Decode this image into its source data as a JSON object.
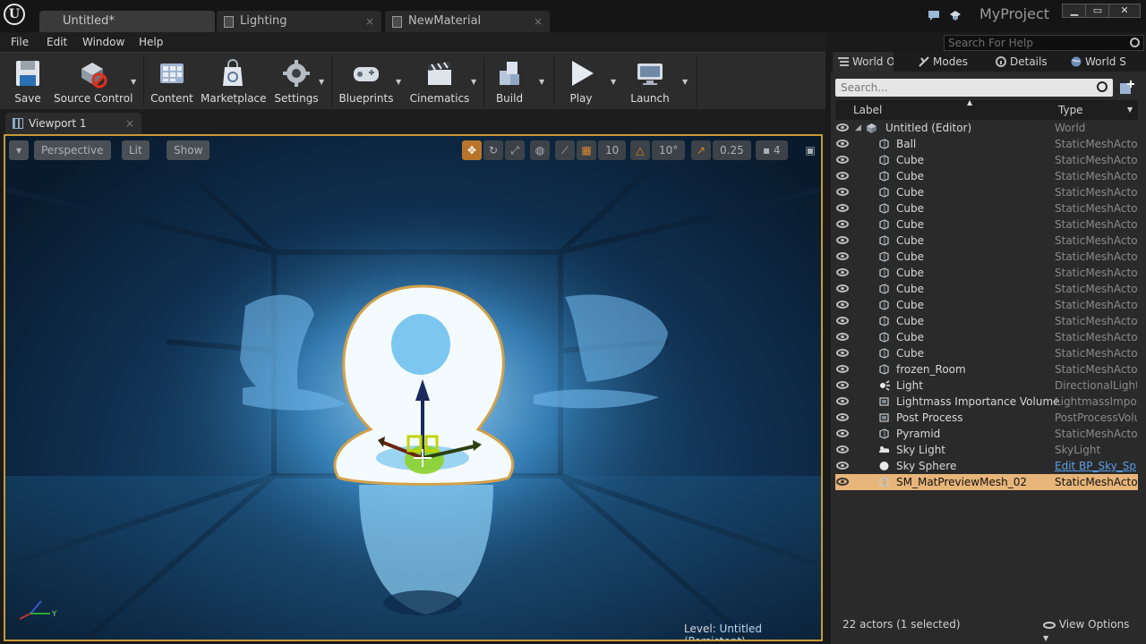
{
  "window": {
    "tabs": [
      {
        "label": "Untitled*",
        "active": true
      },
      {
        "label": "Lighting",
        "active": false
      },
      {
        "label": "NewMaterial",
        "active": false
      }
    ],
    "project_name": "MyProject",
    "close_glyph": "×"
  },
  "menu": [
    "File",
    "Edit",
    "Window",
    "Help"
  ],
  "search_help_placeholder": "Search For Help",
  "toolbar": [
    {
      "label": "Save",
      "icon": "save-icon"
    },
    {
      "label": "Source Control",
      "icon": "source-control-icon",
      "dropdown": true
    },
    {
      "label": "Content",
      "icon": "content-icon"
    },
    {
      "label": "Marketplace",
      "icon": "marketplace-icon"
    },
    {
      "label": "Settings",
      "icon": "settings-icon",
      "dropdown": true
    },
    {
      "label": "Blueprints",
      "icon": "blueprints-icon",
      "dropdown": true
    },
    {
      "label": "Cinematics",
      "icon": "cinematics-icon",
      "dropdown": true
    },
    {
      "label": "Build",
      "icon": "build-icon",
      "dropdown": true
    },
    {
      "label": "Play",
      "icon": "play-icon",
      "dropdown": true
    },
    {
      "label": "Launch",
      "icon": "launch-icon",
      "dropdown": true
    }
  ],
  "viewport": {
    "tab_label": "Viewport 1",
    "perspective": "Perspective",
    "lit": "Lit",
    "show": "Show",
    "grid_snap": "10",
    "rotation_snap": "10°",
    "scale_snap": "0.25",
    "camera_speed": "4",
    "level_label": "Level:",
    "level_name": "Untitled (Persistent)"
  },
  "right_panel": {
    "tabs": [
      {
        "label": "World O",
        "icon": "world-outliner-icon",
        "active": true
      },
      {
        "label": "Modes",
        "icon": "modes-icon"
      },
      {
        "label": "Details",
        "icon": "details-icon"
      },
      {
        "label": "World S",
        "icon": "world-settings-icon"
      }
    ],
    "search_placeholder": "Search...",
    "columns": {
      "label": "Label",
      "type": "Type"
    },
    "rows": [
      {
        "label": "Untitled (Editor)",
        "type": "World",
        "icon": "world-icon",
        "is_world": true
      },
      {
        "label": "Ball",
        "type": "StaticMeshActor",
        "icon": "static-mesh-icon"
      },
      {
        "label": "Cube",
        "type": "StaticMeshActor",
        "icon": "static-mesh-icon"
      },
      {
        "label": "Cube",
        "type": "StaticMeshActor",
        "icon": "static-mesh-icon"
      },
      {
        "label": "Cube",
        "type": "StaticMeshActor",
        "icon": "static-mesh-icon"
      },
      {
        "label": "Cube",
        "type": "StaticMeshActor",
        "icon": "static-mesh-icon"
      },
      {
        "label": "Cube",
        "type": "StaticMeshActor",
        "icon": "static-mesh-icon"
      },
      {
        "label": "Cube",
        "type": "StaticMeshActor",
        "icon": "static-mesh-icon"
      },
      {
        "label": "Cube",
        "type": "StaticMeshActor",
        "icon": "static-mesh-icon"
      },
      {
        "label": "Cube",
        "type": "StaticMeshActor",
        "icon": "static-mesh-icon"
      },
      {
        "label": "Cube",
        "type": "StaticMeshActor",
        "icon": "static-mesh-icon"
      },
      {
        "label": "Cube",
        "type": "StaticMeshActor",
        "icon": "static-mesh-icon"
      },
      {
        "label": "Cube",
        "type": "StaticMeshActor",
        "icon": "static-mesh-icon"
      },
      {
        "label": "Cube",
        "type": "StaticMeshActor",
        "icon": "static-mesh-icon"
      },
      {
        "label": "Cube",
        "type": "StaticMeshActor",
        "icon": "static-mesh-icon"
      },
      {
        "label": "frozen_Room",
        "type": "StaticMeshActor",
        "icon": "static-mesh-icon"
      },
      {
        "label": "Light",
        "type": "DirectionalLight",
        "icon": "directional-light-icon"
      },
      {
        "label": "Lightmass Importance Volume",
        "type": "LightmassImport",
        "icon": "volume-icon"
      },
      {
        "label": "Post Process",
        "type": "PostProcessVolu",
        "icon": "volume-icon"
      },
      {
        "label": "Pyramid",
        "type": "StaticMeshActor",
        "icon": "static-mesh-icon"
      },
      {
        "label": "Sky Light",
        "type": "SkyLight",
        "icon": "sky-light-icon"
      },
      {
        "label": "Sky Sphere",
        "type": "Edit BP_Sky_Sp",
        "icon": "sphere-icon",
        "link": true
      },
      {
        "label": "SM_MatPreviewMesh_02",
        "type": "StaticMeshActor",
        "icon": "static-mesh-icon",
        "selected": true
      }
    ],
    "footer_count": "22 actors (1 selected)",
    "view_options": "View Options"
  },
  "colors": {
    "accent": "#c79a36",
    "selected_row": "#e7b57a",
    "link": "#5aa0e8"
  }
}
